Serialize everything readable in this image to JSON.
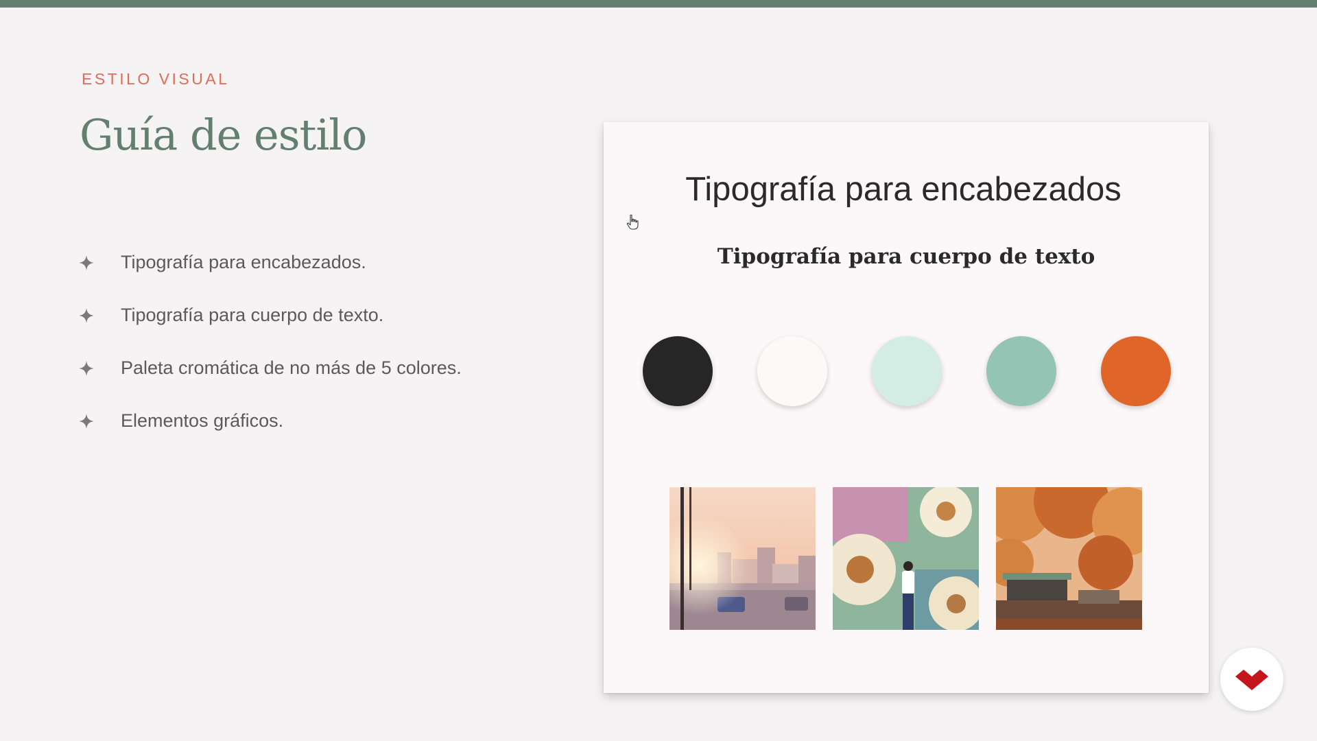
{
  "slide": {
    "eyebrow": "ESTILO VISUAL",
    "title": "Guía de estilo",
    "bullets": [
      "Tipografía para encabezados.",
      "Tipografía para cuerpo de texto.",
      "Paleta cromática de no más de 5 colores.",
      "Elementos gráficos."
    ]
  },
  "style_card": {
    "heading_sample": "Tipografía para encabezados",
    "body_sample": "Tipografía para cuerpo de texto",
    "palette": [
      "#262626",
      "#fbfaf7",
      "#d3ede5",
      "#93c4b4",
      "#e06528"
    ],
    "photos": [
      "city-street-sunset-photo",
      "sunflower-mural-woman-photo",
      "autumn-park-cafe-photo"
    ]
  },
  "colors": {
    "accent_green": "#637f70",
    "accent_coral": "#de6c57",
    "logo_red": "#c4151c"
  }
}
